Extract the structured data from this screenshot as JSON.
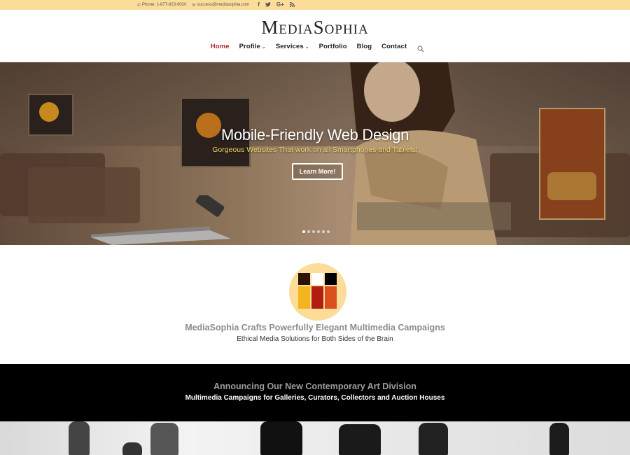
{
  "topbar": {
    "phone": "Phone: 1-877-823-9020",
    "email": "success@mediasophia.com",
    "social": [
      {
        "icon": "facebook-icon",
        "glyph": "f"
      },
      {
        "icon": "twitter-icon",
        "glyph": "t"
      },
      {
        "icon": "google-plus-icon",
        "glyph": "G+"
      },
      {
        "icon": "rss-icon",
        "glyph": "rss"
      }
    ]
  },
  "header": {
    "logo_part1": "Media",
    "logo_part2": "Sophia",
    "nav": [
      {
        "label": "Home",
        "active": true,
        "dropdown": false
      },
      {
        "label": "Profile",
        "active": false,
        "dropdown": true
      },
      {
        "label": "Services",
        "active": false,
        "dropdown": true
      },
      {
        "label": "Portfolio",
        "active": false,
        "dropdown": false
      },
      {
        "label": "Blog",
        "active": false,
        "dropdown": false
      },
      {
        "label": "Contact",
        "active": false,
        "dropdown": false
      }
    ],
    "active_color": "#a9262b"
  },
  "hero": {
    "title": "Mobile-Friendly Web Design",
    "subtitle": "Gorgeous Websites That work on all Smartphones and Tablets!",
    "button": "Learn More!",
    "subtitle_color": "#f3d56b"
  },
  "intro": {
    "title": "MediaSophia Crafts Powerfully Elegant Multimedia Campaigns",
    "subtitle": "Ethical Media Solutions for Both Sides of the Brain"
  },
  "banner": {
    "title": "Announcing Our New Contemporary Art Division",
    "subtitle": "Multimedia Campaigns for Galleries, Curators, Collectors and Auction Houses"
  },
  "colors": {
    "topbar": "#fbdc99",
    "banner": "#000000"
  }
}
